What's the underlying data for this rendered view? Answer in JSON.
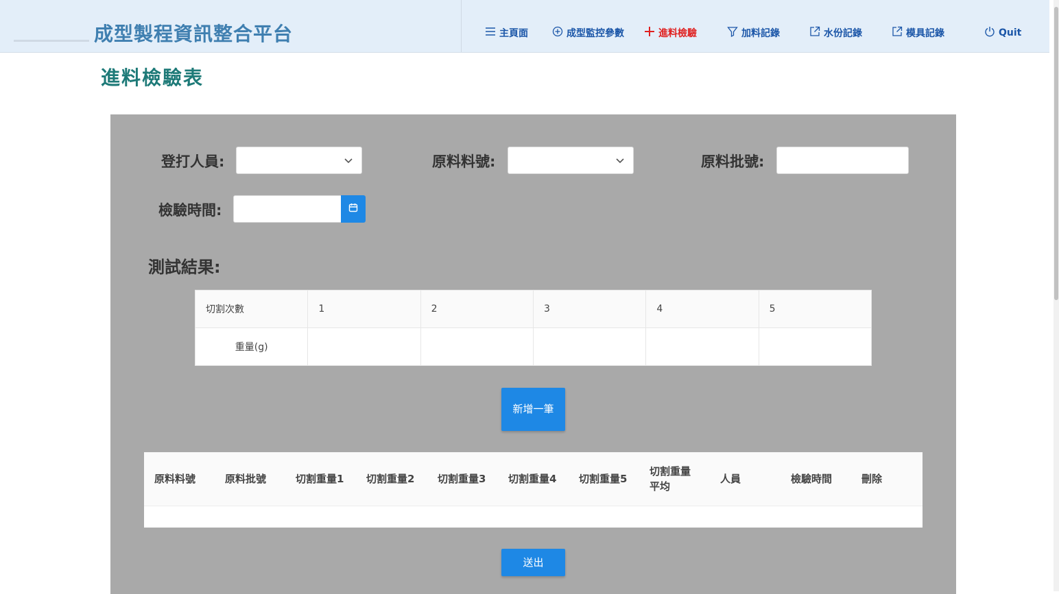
{
  "header": {
    "app_title": "成型製程資訊整合平台",
    "nav": [
      {
        "label": "主頁面",
        "icon": "menu-icon"
      },
      {
        "label": "成型監控參數",
        "icon": "plus-circle-icon"
      },
      {
        "label": "進料檢驗",
        "icon": "plus-icon",
        "active": true
      },
      {
        "label": "加料記錄",
        "icon": "filter-icon"
      },
      {
        "label": "水份記錄",
        "icon": "external-link-icon"
      },
      {
        "label": "模具記錄",
        "icon": "external-link-icon"
      },
      {
        "label": "Quit",
        "icon": "power-icon"
      }
    ]
  },
  "page": {
    "title": "進料檢驗表"
  },
  "form": {
    "operator_label": "登打人員:",
    "operator_value": "",
    "material_no_label": "原料料號:",
    "material_no_value": "",
    "batch_label": "原料批號:",
    "batch_value": "",
    "inspect_time_label": "檢驗時間:",
    "inspect_time_value": ""
  },
  "test": {
    "section_title": "測試結果:",
    "cut_label": "切割次數",
    "cut_numbers": [
      "1",
      "2",
      "3",
      "4",
      "5"
    ],
    "weight_label": "重量(g)",
    "weights": [
      "",
      "",
      "",
      "",
      ""
    ]
  },
  "buttons": {
    "add_label": "新增一筆",
    "submit_label": "送出"
  },
  "records": {
    "columns": [
      "原料料號",
      "原料批號",
      "切割重量1",
      "切割重量2",
      "切割重量3",
      "切割重量4",
      "切割重量5",
      "切割重量平均",
      "人員",
      "檢驗時間",
      "刪除"
    ],
    "rows": []
  },
  "colors": {
    "header_bg": "#e3eef9",
    "title_blue": "#3f7fb0",
    "nav_blue": "#1b56a8",
    "nav_active": "#e02020",
    "page_title": "#1e7a78",
    "panel_bg": "#a9a9a9",
    "button_blue": "#1e88e5"
  }
}
